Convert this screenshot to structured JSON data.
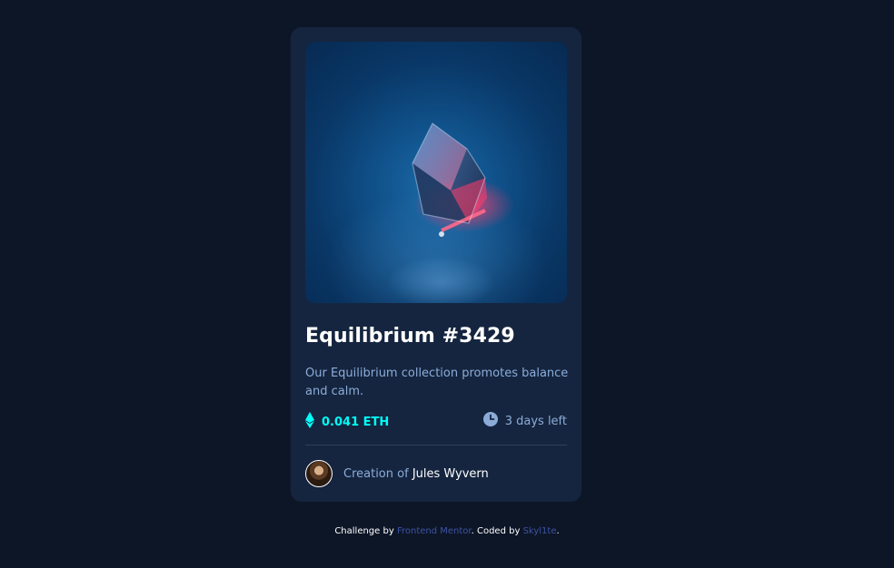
{
  "card": {
    "title": "Equilibrium #3429",
    "description": "Our Equilibrium collection promotes balance and calm.",
    "price": "0.041 ETH",
    "time_left": "3 days left",
    "creator_prefix": "Creation of",
    "creator_name": "Jules Wyvern"
  },
  "attribution": {
    "prefix": "Challenge by",
    "link1": "Frontend Mentor",
    "middle": ". Coded by",
    "link2": "Skyl1te",
    "suffix": "."
  },
  "icons": {
    "price": "ethereum-icon",
    "time": "clock-icon"
  },
  "colors": {
    "page_bg": "#0d1627",
    "card_bg": "#15253f",
    "accent_cyan": "#00fff8",
    "soft_blue": "#8bacd9",
    "link_blue": "#3e52a3"
  }
}
